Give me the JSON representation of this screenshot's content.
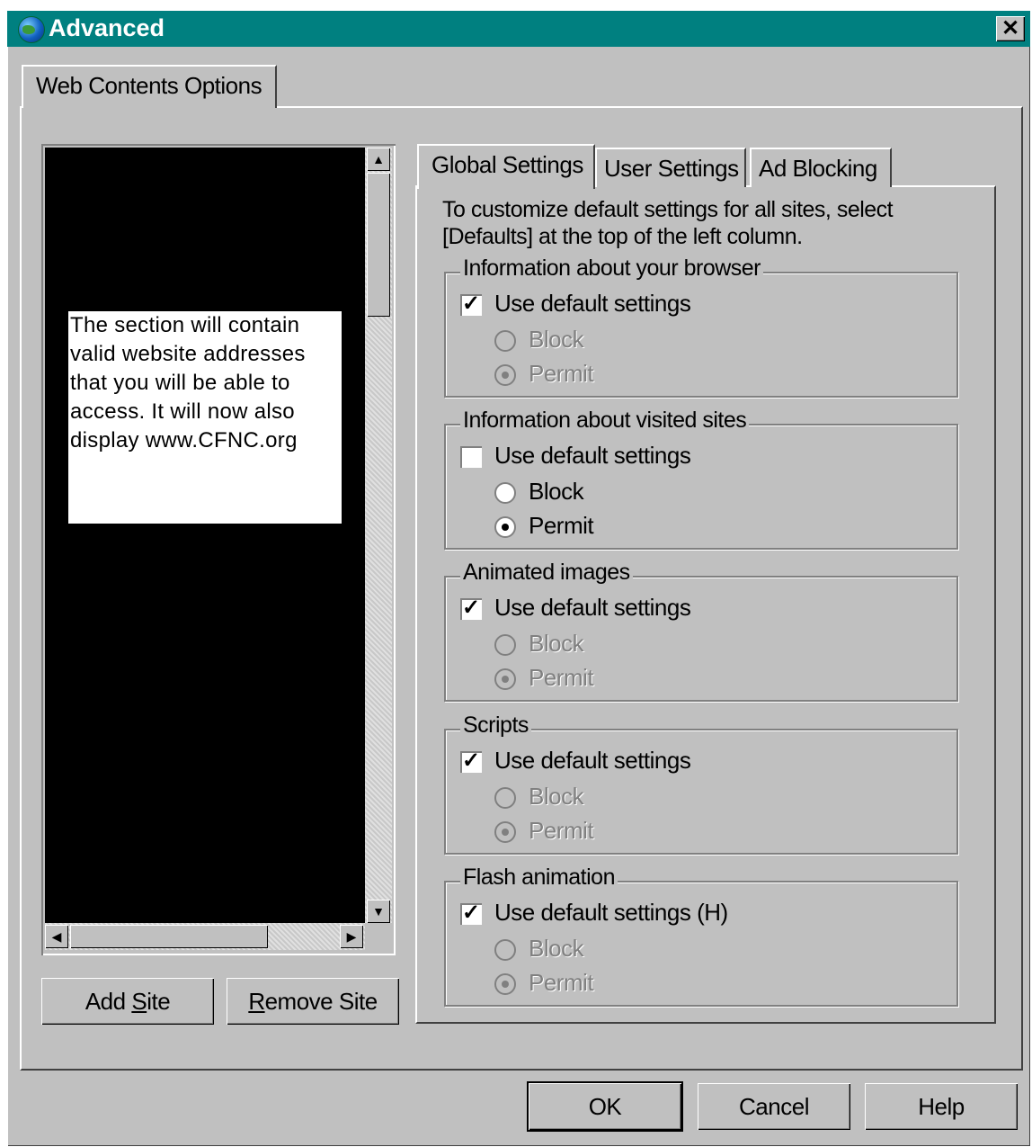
{
  "window": {
    "title": "Advanced",
    "close_label": "✕"
  },
  "outer_tab": {
    "label": "Web Contents Options"
  },
  "site_list": {
    "note": "The section will contain valid website addresses that you will be able to access.  It will now also display www.CFNC.org"
  },
  "site_buttons": {
    "add_pre": "Add ",
    "add_key": "S",
    "add_post": "ite",
    "remove_key": "R",
    "remove_post": "emove Site"
  },
  "inner_tabs": [
    "Global Settings",
    "User Settings",
    "Ad Blocking"
  ],
  "description": "To customize default settings for all sites, select [Defaults] at the top of the left column.",
  "groups": [
    {
      "legend": "Information about your browser",
      "checkbox_label": "Use default settings",
      "checked": true,
      "block_label": "Block",
      "permit_label": "Permit",
      "selected": "Permit",
      "enabled": false
    },
    {
      "legend": "Information about visited sites",
      "checkbox_label": "Use default settings",
      "checked": false,
      "block_label": "Block",
      "permit_label": "Permit",
      "selected": "Permit",
      "enabled": true
    },
    {
      "legend": "Animated images",
      "checkbox_label": "Use default settings",
      "checked": true,
      "block_label": "Block",
      "permit_label": "Permit",
      "selected": "Permit",
      "enabled": false
    },
    {
      "legend": "Scripts",
      "checkbox_label": "Use default settings",
      "checked": true,
      "block_label": "Block",
      "permit_label": "Permit",
      "selected": "Permit",
      "enabled": false
    },
    {
      "legend": "Flash animation",
      "checkbox_label": "Use default settings (H)",
      "checked": true,
      "block_label": "Block",
      "permit_label": "Permit",
      "selected": "Permit",
      "enabled": false
    }
  ],
  "footer": {
    "ok": "OK",
    "cancel": "Cancel",
    "help": "Help"
  },
  "icons": {
    "scroll_up": "▲",
    "scroll_down": "▼",
    "scroll_left": "◀",
    "scroll_right": "▶"
  }
}
